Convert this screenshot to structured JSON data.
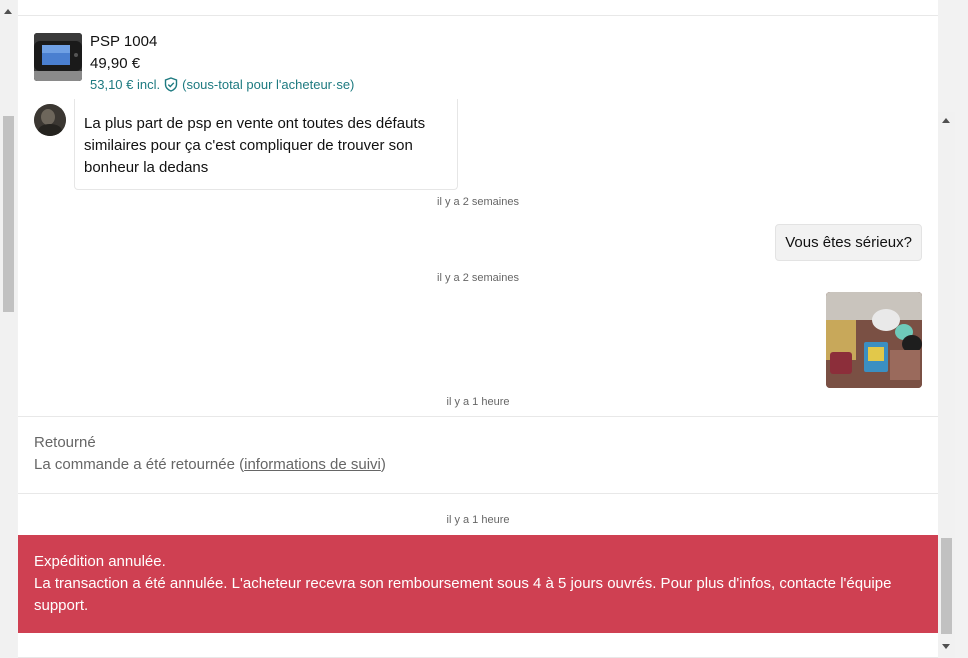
{
  "item": {
    "title": "PSP 1004",
    "price": "49,90 €",
    "subtotal": "53,10 € incl.",
    "subtotal_note": "(sous-total pour l'acheteur·se)",
    "thumbnail_icon": "psp-console-photo"
  },
  "messages": [
    {
      "type": "incoming",
      "text": "La plus part de psp en vente ont toutes des défauts similaires pour ça c'est compliquer de trouver son bonheur la dedans",
      "timestamp": "il y a 2 semaines"
    },
    {
      "type": "outgoing",
      "text": "Vous êtes sérieux?",
      "timestamp": "il y a 2 semaines"
    },
    {
      "type": "outgoing-photo",
      "timestamp": "il y a 1 heure"
    }
  ],
  "status_returned": {
    "title": "Retourné",
    "text_before": "La commande a été retournée (",
    "link": "informations de suivi",
    "text_after": ")"
  },
  "status_timestamp": "il y a 1 heure",
  "alert": {
    "title": "Expédition annulée.",
    "body": "La transaction a été annulée. L'acheteur recevra son remboursement sous 4 à 5 jours ouvrés. Pour plus d'infos, contacte l'équipe support."
  },
  "colors": {
    "accent": "#1d7a80",
    "alert_bg": "#cf4052"
  }
}
